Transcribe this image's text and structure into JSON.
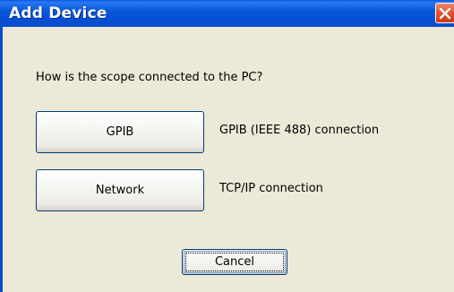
{
  "window": {
    "title": "Add Device"
  },
  "dialog": {
    "question": "How is the scope connected to the PC?",
    "options": [
      {
        "button_label": "GPIB",
        "description": "GPIB (IEEE 488) connection"
      },
      {
        "button_label": "Network",
        "description": "TCP/IP connection"
      }
    ],
    "cancel_label": "Cancel"
  },
  "colors": {
    "titlebar": "#0550d4",
    "window_background": "#ece9d8",
    "close_button": "#e2532d",
    "button_border": "#003c74"
  },
  "icons": {
    "close": "close-icon"
  }
}
